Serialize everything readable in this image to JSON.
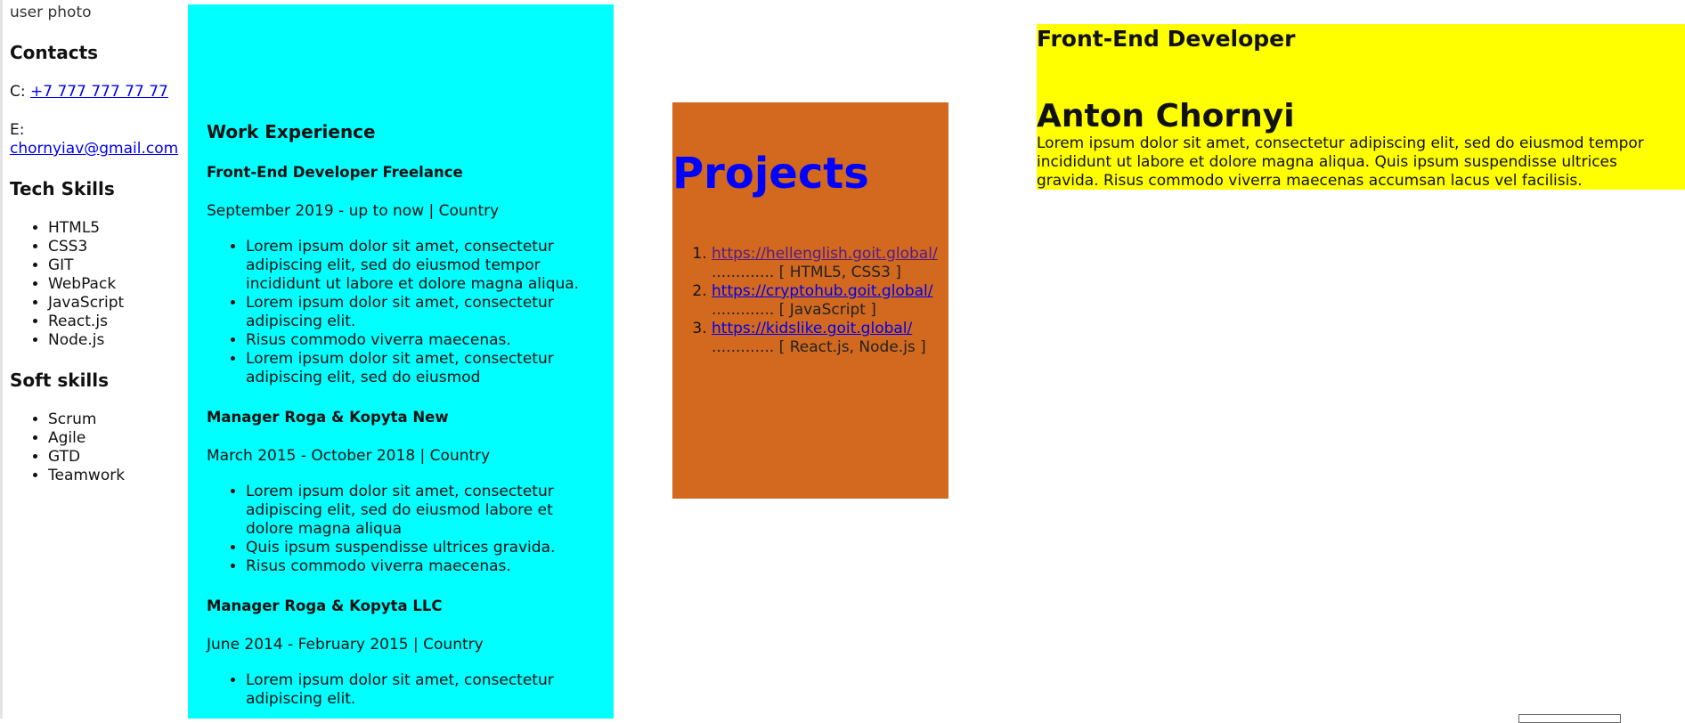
{
  "sidebar": {
    "photo_alt": "user photo",
    "contacts_title": "Contacts",
    "phone_prefix": "C:",
    "phone": "+7 777 777 77 77",
    "email_prefix": "E:",
    "email": "chornyiav@gmail.com",
    "tech_title": "Tech Skills",
    "tech_skills": [
      "HTML5",
      "CSS3",
      "GIT",
      "WebPack",
      "JavaScript",
      "React.js",
      "Node.js"
    ],
    "soft_title": "Soft skills",
    "soft_skills": [
      "Scrum",
      "Agile",
      "GTD",
      "Teamwork"
    ]
  },
  "work": {
    "title": "Work Experience",
    "jobs": [
      {
        "title": "Front-End Developer Freelance",
        "period": "September 2019 - up to now | Country",
        "items": [
          "Lorem ipsum dolor sit amet, consectetur adipiscing elit, sed do eiusmod tempor incididunt ut labore et dolore magna aliqua.",
          "Lorem ipsum dolor sit amet, consectetur adipiscing elit.",
          "Risus commodo viverra maecenas.",
          "Lorem ipsum dolor sit amet, consectetur adipiscing elit, sed do eiusmod"
        ]
      },
      {
        "title": "Manager Roga & Kopyta New",
        "period": "March 2015 - October 2018 | Country",
        "items": [
          "Lorem ipsum dolor sit amet, consectetur adipiscing elit, sed do eiusmod labore et dolore magna aliqua",
          "Quis ipsum suspendisse ultrices gravida.",
          "Risus commodo viverra maecenas."
        ]
      },
      {
        "title": "Manager Roga & Kopyta LLC",
        "period": "June 2014 - February 2015 | Country",
        "items": [
          "Lorem ipsum dolor sit amet, consectetur adipiscing elit."
        ]
      }
    ]
  },
  "projects": {
    "title": "Projects",
    "items": [
      {
        "url": "https://hellenglish.goit.global/",
        "stack": "............. [ HTML5, CSS3 ]"
      },
      {
        "url": "https://cryptohub.goit.global/",
        "stack": "............. [ JavaScript ]"
      },
      {
        "url": "https://kidslike.goit.global/",
        "stack": "............. [ React.js, Node.js ]"
      }
    ]
  },
  "header": {
    "role": "Front-End Developer",
    "name": "Anton Chornyi",
    "summary": "Lorem ipsum dolor sit amet, consectetur adipiscing elit, sed do eiusmod tempor incididunt ut labore et dolore magna aliqua. Quis ipsum suspendisse ultrices gravida. Risus commodo viverra maecenas accumsan lacus vel facilisis."
  },
  "colors": {
    "work_bg": "#00ffff",
    "projects_bg": "#d2691e",
    "projects_title": "#0000ff",
    "header_bg": "#ffff00",
    "link": "#0000ee"
  }
}
